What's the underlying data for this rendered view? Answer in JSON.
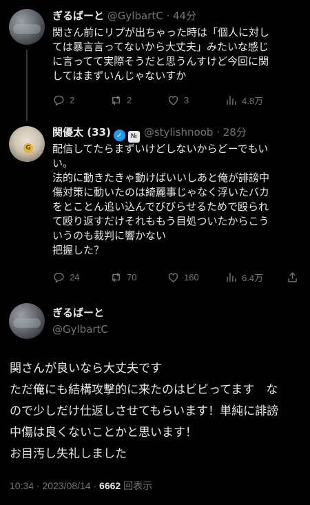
{
  "tweets": [
    {
      "name": "ぎるばーと",
      "handle": "@GylbartC",
      "time": "44分",
      "text": "関さん前にリプが出ちゃった時は「個人に対し\nては暴言言ってないから大丈夫」みたいな感じ\nに言ってて実際そうだと思うんすけど今回に関\nしてはまずいんじゃないすか",
      "replies": "2",
      "retweets": "2",
      "likes": "3",
      "views": "4.8万"
    },
    {
      "name": "関優太 (33)",
      "handle": "@stylishnoob",
      "time": "28分",
      "org_badge": "№",
      "text": "配信してたらまずいけどしないからどーでもい\nい。\n法的に動きたきゃ動けばいいしあと俺が誹謗中\n傷対策に動いたのは綺麗事じゃなく浮いたバカ\nをとことん追い込んでびびらせるためで殴られ\nて殴り返すだけそれももう目処ついたからこう\nいうのも裁判に響かない\n把握した？",
      "replies": "24",
      "retweets": "70",
      "likes": "160",
      "views": "6.4万"
    }
  ],
  "main": {
    "name": "ぎるばーと",
    "handle": "@GylbartC",
    "text": "関さんが良いなら大丈夫です\nただ俺にも結構攻撃的に来たのはビビってます　な\nので少しだけ仕返しさせてもらいます！単純に誹謗\n中傷は良くないことかと思います！\nお目汚し失礼しました",
    "time": "10:34",
    "date": "2023/08/14",
    "views_count": "6662",
    "views_label": "回表示"
  },
  "separator": " · "
}
